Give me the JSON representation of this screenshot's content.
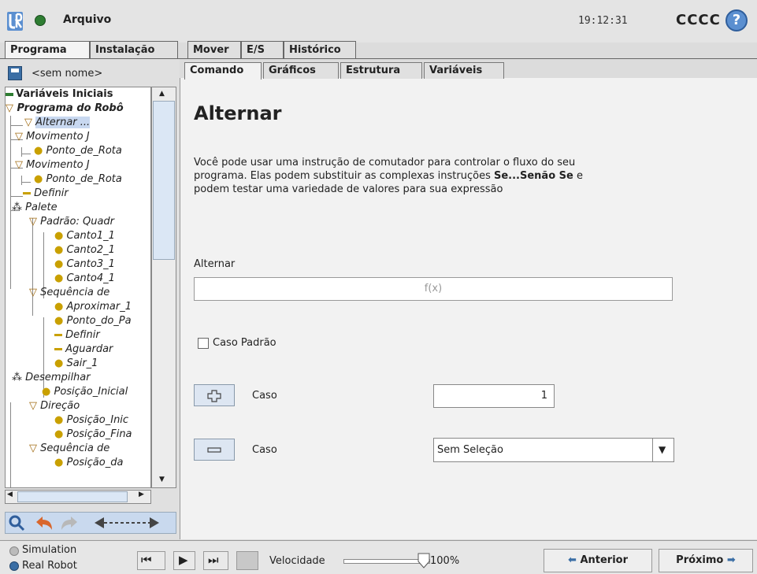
{
  "header": {
    "menu_file": "Arquivo",
    "clock": "19:12:31",
    "robot_name": "CCCC",
    "help": "?"
  },
  "main_tabs": [
    "Programa",
    "Instalação",
    "Mover",
    "E/S",
    "Histórico"
  ],
  "program": {
    "name": "<sem nome>"
  },
  "tree": [
    "Variáveis Iniciais",
    "Programa do Robô",
    "Alternar ...",
    "Movimento J",
    "Ponto_de_Rota",
    "Movimento J",
    "Ponto_de_Rota",
    "Definir",
    "Palete",
    "Padrão: Quadr",
    "Canto1_1",
    "Canto2_1",
    "Canto3_1",
    "Canto4_1",
    "Sequência de",
    "Aproximar_1",
    "Ponto_do_Pa",
    "Definir",
    "Aguardar",
    "Sair_1",
    "Desempilhar",
    "Posição_Inicial",
    "Direção",
    "Posição_Inic",
    "Posição_Fina",
    "Sequência de",
    "Posição_da"
  ],
  "sub_tabs": [
    "Comando",
    "Gráficos",
    "Estrutura",
    "Variáveis"
  ],
  "content": {
    "title": "Alternar",
    "desc_line1": "Você pode usar uma instrução de comutador para controlar o fluxo do seu",
    "desc_line2a": "programa. Elas podem substituir as complexas instruções ",
    "desc_line2b": "Se...Senão Se",
    "desc_line2c": " e",
    "desc_line3": "podem testar uma variedade de valores para sua expressão",
    "switch_label": "Alternar",
    "expr_placeholder": "f(x)",
    "default_case_label": "Caso Padrão",
    "add_case_label": "Caso",
    "add_case_value": "1",
    "remove_case_label": "Caso",
    "remove_case_select": "Sem Seleção"
  },
  "bottom": {
    "simulation": "Simulation",
    "real_robot": "Real Robot",
    "speed_label": "Velocidade",
    "speed_value": "100%",
    "speed_fraction": 1.0,
    "prev": "Anterior",
    "next": "Próximo"
  },
  "colors": {
    "accent": "#3a6ea5",
    "selected": "#c8d8f0",
    "green": "#2e7d32"
  }
}
